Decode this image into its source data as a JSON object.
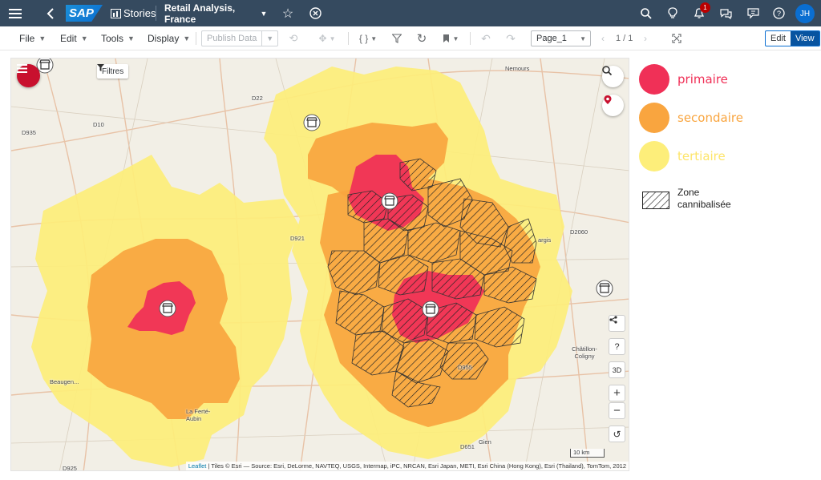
{
  "shell": {
    "brand": "SAP",
    "app_title": "Stories",
    "story_title": "Retail Analysis, France",
    "notification_count": "1",
    "user_initials": "JH",
    "colors": {
      "shell_bg": "#354a5f",
      "avatar": "#0a6ed1",
      "badge": "#bb0000"
    }
  },
  "toolbar": {
    "menus": [
      "File",
      "Edit",
      "Tools",
      "Display"
    ],
    "publish_label": "Publish Data",
    "page_select": "Page_1",
    "page_counter": "1 / 1",
    "mode_edit": "Edit",
    "mode_view": "View"
  },
  "map": {
    "filter_label": "Filtres",
    "attribution_link": "Leaflet",
    "attribution": "| Tiles © Esri — Source: Esri, DeLorme, NAVTEQ, USGS, Intermap, iPC, NRCAN, Esri Japan, METI, Esri China (Hong Kong), Esri (Thailand), TomTom, 2012",
    "scale_label": "10 km",
    "control_3d": "3D",
    "control_help": "?",
    "zoom_in": "+",
    "zoom_out": "−",
    "place_labels": [
      "Nemours",
      "Châtillon-Coligny",
      "Beaugen...",
      "La Ferté-Aubin",
      "Gien",
      "argis"
    ],
    "road_labels": [
      "D22",
      "D935",
      "D10",
      "D921",
      "D2060",
      "D651",
      "D925",
      "D955"
    ],
    "zone_colors": {
      "primaire": "#f03057",
      "secondaire": "#f9a53f",
      "tertiaire": "#fdee7a"
    }
  },
  "legend": {
    "items": [
      {
        "label": "primaire",
        "color": "#f03057"
      },
      {
        "label": "secondaire",
        "color": "#f9a53f"
      },
      {
        "label": "tertiaire",
        "color": "#fdee7a"
      }
    ],
    "hatched_label_line1": "Zone",
    "hatched_label_line2": "cannibalisée"
  }
}
